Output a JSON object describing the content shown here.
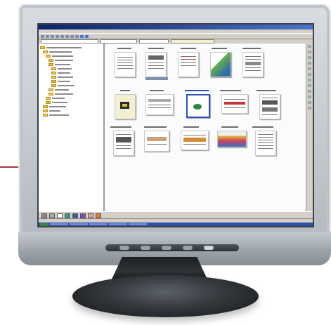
{
  "scene": {
    "subject": "flat-panel-monitor",
    "accent_color": "#b5343a",
    "bezel_color": "#c9ced5",
    "stand_color": "#2f3439"
  },
  "screen": {
    "window_title_text": "",
    "menu_items": [],
    "thumbnails_count": 15
  }
}
